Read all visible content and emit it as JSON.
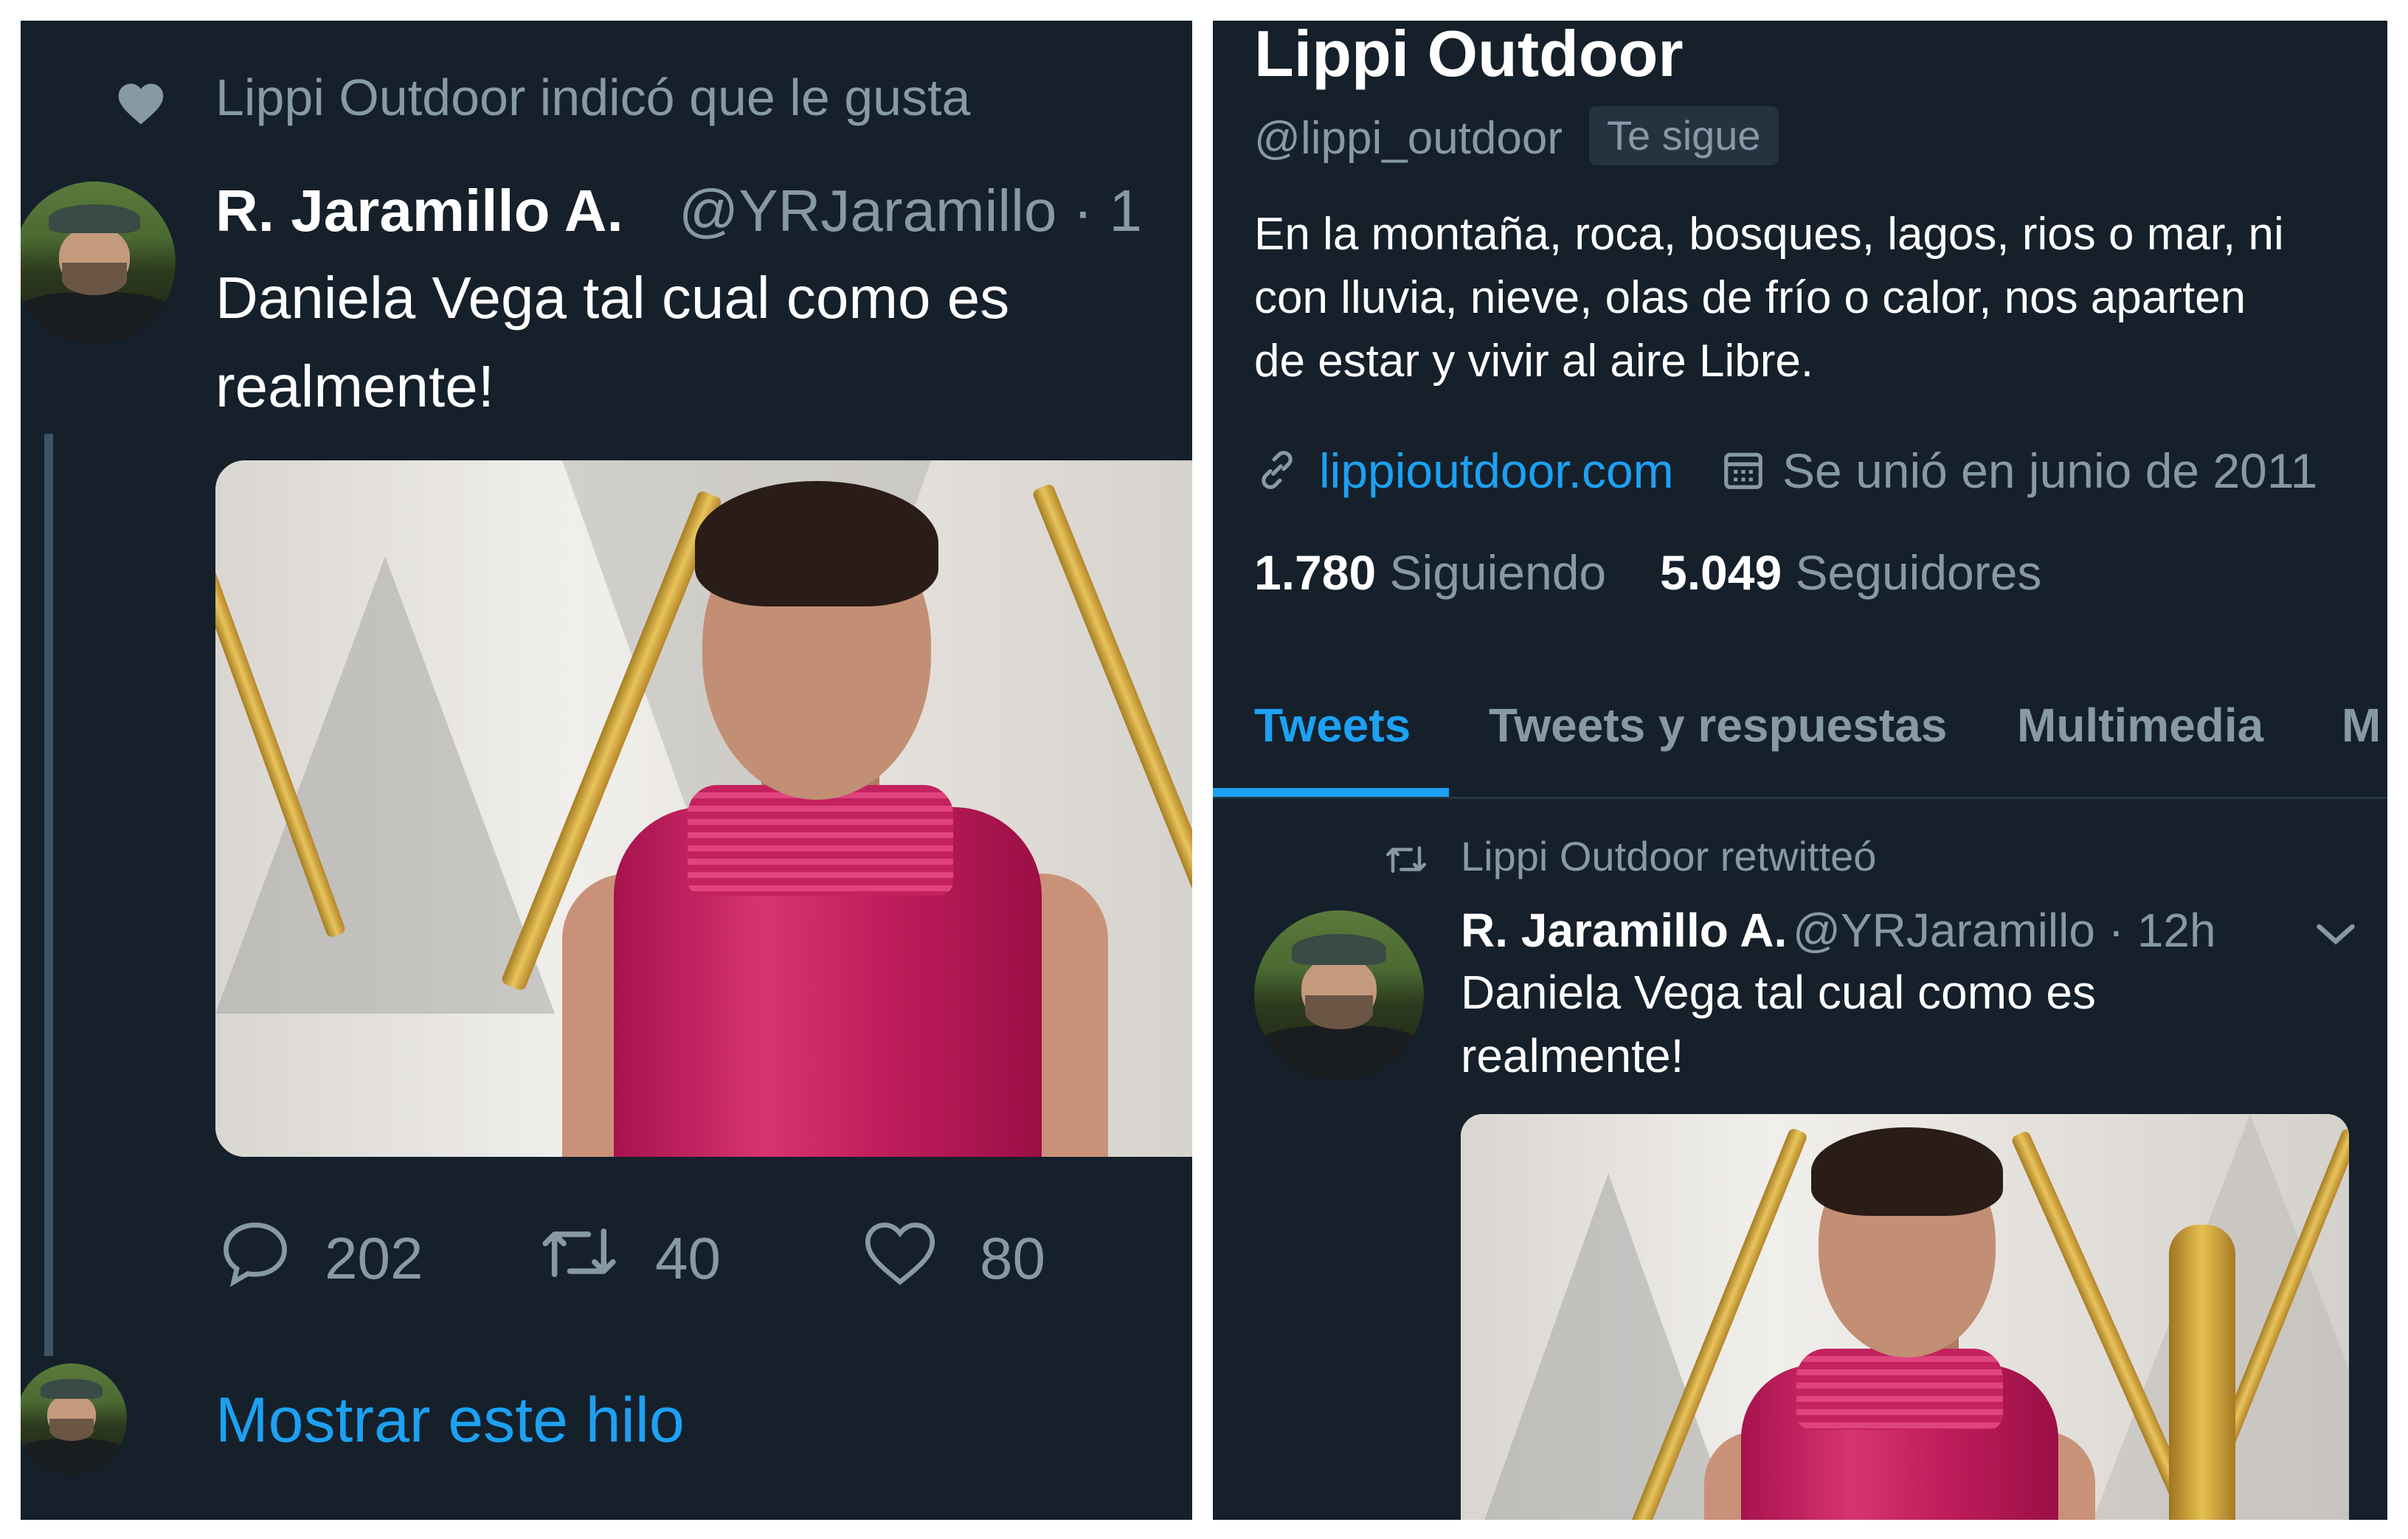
{
  "left": {
    "like_context": "Lippi Outdoor indicó que le gusta",
    "author_name": "R. Jaramillo A.",
    "author_handle": "@YRJaramillo · 1",
    "tweet_text_line1": "Daniela Vega tal cual como es",
    "tweet_text_line2": "realmente!",
    "reply_count": "202",
    "retweet_count": "40",
    "like_count": "80",
    "show_thread": "Mostrar este hilo"
  },
  "right": {
    "profile_name": "Lippi Outdoor",
    "profile_handle": "@lippi_outdoor",
    "follows_you_badge": "Te sigue",
    "bio_line1": "En la montaña, roca, bosques, lagos, rios o mar, ni",
    "bio_line2": "con lluvia, nieve, olas de frío o calor, nos aparten",
    "bio_line3": "de estar y vivir al aire Libre.",
    "website": "lippioutdoor.com",
    "joined": "Se unió en junio de 2011",
    "following_count": "1.780",
    "following_label": "Siguiendo",
    "followers_count": "5.049",
    "followers_label": "Seguidores",
    "tabs": [
      {
        "label": "Tweets",
        "active": true
      },
      {
        "label": "Tweets y respuestas",
        "active": false
      },
      {
        "label": "Multimedia",
        "active": false
      },
      {
        "label": "M",
        "active": false
      }
    ],
    "retweet_context": "Lippi Outdoor retwitteó",
    "author_name": "R. Jaramillo A.",
    "author_handle": "@YRJaramillo · 12h",
    "tweet_text_line1": "Daniela Vega tal cual como es",
    "tweet_text_line2": "realmente!"
  },
  "colors": {
    "background": "#15202b",
    "accent": "#1da1f2",
    "muted_text": "#8899a6",
    "text": "#ffffff"
  },
  "icons": [
    "heart-icon",
    "reply-icon",
    "retweet-icon",
    "link-icon",
    "calendar-icon",
    "chevron-down-icon"
  ]
}
